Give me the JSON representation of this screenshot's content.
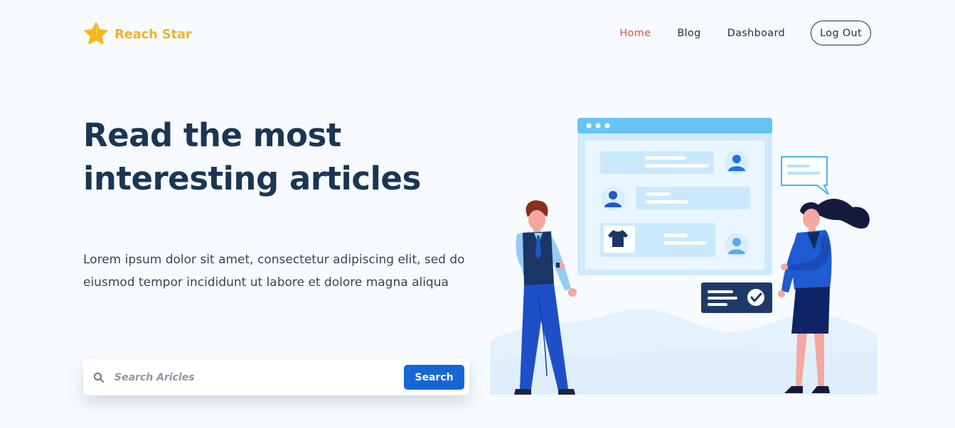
{
  "brand": {
    "name": "Reach Star",
    "logo_icon": "star-icon",
    "color": "#f0b429"
  },
  "nav": {
    "items": [
      {
        "label": "Home",
        "active": true
      },
      {
        "label": "Blog",
        "active": false
      },
      {
        "label": "Dashboard",
        "active": false
      }
    ],
    "logout_label": "Log Out",
    "active_color": "#e4503b"
  },
  "hero": {
    "title_line1": "Read the most",
    "title_line2": "interesting articles",
    "text_line1": "Lorem ipsum dolor sit amet, consectetur adipiscing elit, sed do",
    "text_line2": "eiusmod tempor incididunt ut labore et dolore magna aliqua"
  },
  "search": {
    "icon": "search-icon",
    "placeholder": "Search Aricles",
    "value": "",
    "button_label": "Search",
    "button_color": "#1766d6"
  },
  "illustration": {
    "icons": [
      "browser-window",
      "user-avatar-icon",
      "tshirt-icon",
      "chat-bubble-icon",
      "checkmark-icon",
      "man-figure",
      "woman-figure"
    ]
  },
  "colors": {
    "title": "#1a3652",
    "background": "#f7fbff"
  }
}
